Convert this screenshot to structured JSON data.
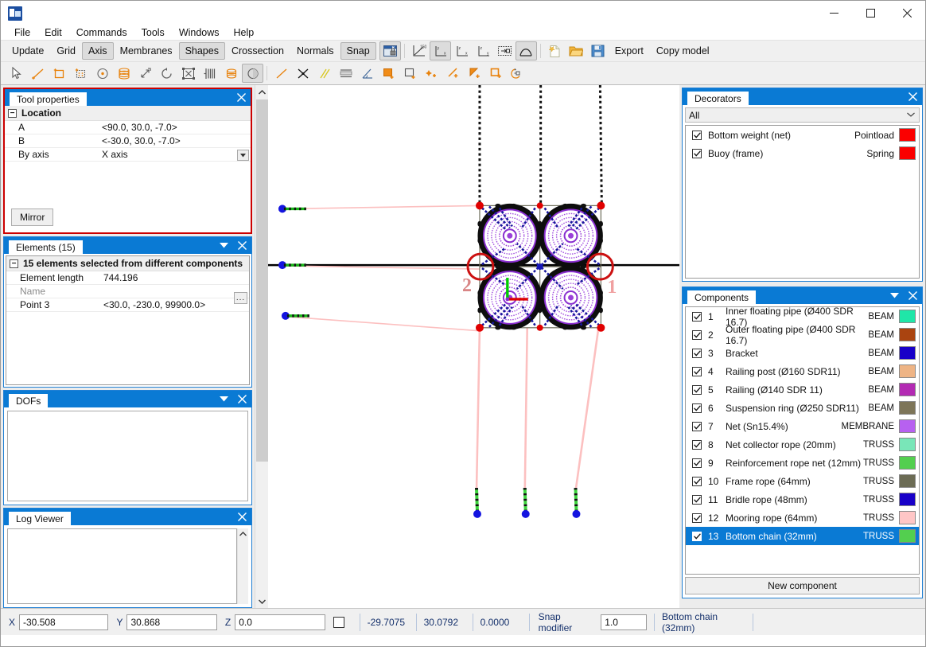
{
  "window": {
    "app_icon": "app-icon",
    "minimize": "—",
    "maximize": "□",
    "close": "✕"
  },
  "menu": {
    "items": [
      "File",
      "Edit",
      "Commands",
      "Tools",
      "Windows",
      "Help"
    ]
  },
  "toolbar_main": {
    "buttons": [
      {
        "label": "Update",
        "active": false
      },
      {
        "label": "Grid",
        "active": false
      },
      {
        "label": "Axis",
        "active": true
      },
      {
        "label": "Membranes",
        "active": false
      },
      {
        "label": "Shapes",
        "active": true
      },
      {
        "label": "Crossection",
        "active": false
      },
      {
        "label": "Normals",
        "active": false
      },
      {
        "label": "Snap",
        "active": true
      }
    ],
    "icon_buttons": [
      {
        "name": "lock-view-icon",
        "active": true
      },
      {
        "name": "iso-view-icon",
        "active": false
      },
      {
        "name": "front-view-icon",
        "active": true
      },
      {
        "name": "side-view-icon",
        "active": false
      },
      {
        "name": "top-view-icon",
        "active": false
      },
      {
        "name": "zoom-extents-icon",
        "active": false
      },
      {
        "name": "shaded-shape-icon",
        "active": true
      },
      {
        "name": "new-file-icon",
        "active": false
      },
      {
        "name": "open-folder-icon",
        "active": false
      },
      {
        "name": "save-disk-icon",
        "active": false
      }
    ],
    "export_label": "Export",
    "copy_model_label": "Copy model"
  },
  "toolbar_tools": {
    "icons": [
      "select-arrow-icon",
      "add-line-icon",
      "add-rectangle-icon",
      "add-grid-icon",
      "add-point-icon",
      "cylinder-icon",
      "scale-icon",
      "rotate-icon",
      "fit-selection-icon",
      "mirror-icon",
      "extrude-icon",
      "shade-half-icon",
      "line-icon",
      "intersect-icon",
      "parallel-icon",
      "equal-length-icon",
      "angle-icon",
      "fill-square-icon",
      "offset-square-icon",
      "add-node-icon",
      "add-beam-icon",
      "add-triangle-icon",
      "add-quad-icon",
      "add-spring-icon"
    ]
  },
  "tool_properties": {
    "title": "Tool properties",
    "close": "✕",
    "group": {
      "label": "Location",
      "expander": "−"
    },
    "rows": [
      {
        "key": "A",
        "value": "<90.0, 30.0, -7.0>",
        "kind": "text"
      },
      {
        "key": "B",
        "value": "<-30.0, 30.0, -7.0>",
        "kind": "text"
      },
      {
        "key": "By axis",
        "value": "X axis",
        "kind": "combo"
      }
    ],
    "mirror_button": "Mirror"
  },
  "elements": {
    "title": "Elements (15)",
    "close": "✕",
    "menu": "▼",
    "group": {
      "label": "15 elements selected from different components",
      "expander": "−"
    },
    "rows": [
      {
        "key": "Element length",
        "value": "744.196",
        "kind": "text",
        "dim": false
      },
      {
        "key": "Name",
        "value": "",
        "kind": "dots",
        "dim": true
      },
      {
        "key": "Point 3",
        "value": "<30.0, -230.0, 99900.0>",
        "kind": "text",
        "dim": false
      }
    ]
  },
  "dofs": {
    "title": "DOFs",
    "close": "✕",
    "menu": "▼"
  },
  "log_viewer": {
    "title": "Log Viewer",
    "close": "✕"
  },
  "decorators": {
    "title": "Decorators",
    "close": "✕",
    "filter": "All",
    "filter_chevron": "⌄",
    "items": [
      {
        "checked": true,
        "name": "Bottom weight (net)",
        "type": "Pointload",
        "color": "#fb0000"
      },
      {
        "checked": true,
        "name": "Buoy (frame)",
        "type": "Spring",
        "color": "#fb0000"
      }
    ]
  },
  "components": {
    "title": "Components",
    "close": "✕",
    "menu": "▼",
    "new_button": "New component",
    "items": [
      {
        "num": "1",
        "checked": true,
        "name": "Inner floating pipe (Ø400 SDR 16.7)",
        "type": "BEAM",
        "color": "#1fe6a8",
        "selected": false
      },
      {
        "num": "2",
        "checked": true,
        "name": "Outer floating pipe (Ø400 SDR 16.7)",
        "type": "BEAM",
        "color": "#aa4410",
        "selected": false
      },
      {
        "num": "3",
        "checked": true,
        "name": "Bracket",
        "type": "BEAM",
        "color": "#1800c8",
        "selected": false
      },
      {
        "num": "4",
        "checked": true,
        "name": "Railing post (Ø160 SDR11)",
        "type": "BEAM",
        "color": "#eeb485",
        "selected": false
      },
      {
        "num": "5",
        "checked": true,
        "name": "Railing (Ø140 SDR 11)",
        "type": "BEAM",
        "color": "#b32bb3",
        "selected": false
      },
      {
        "num": "6",
        "checked": true,
        "name": "Suspension ring (Ø250 SDR11)",
        "type": "BEAM",
        "color": "#7d7558",
        "selected": false
      },
      {
        "num": "7",
        "checked": true,
        "name": "Net (Sn15.4%)",
        "type": "MEMBRANE",
        "color": "#b761f0",
        "selected": false
      },
      {
        "num": "8",
        "checked": true,
        "name": "Net collector rope (20mm)",
        "type": "TRUSS",
        "color": "#79e6b8",
        "selected": false
      },
      {
        "num": "9",
        "checked": true,
        "name": "Reinforcement rope net (12mm)",
        "type": "TRUSS",
        "color": "#53cf4f",
        "selected": false
      },
      {
        "num": "10",
        "checked": true,
        "name": "Frame rope (64mm)",
        "type": "TRUSS",
        "color": "#6b6b54",
        "selected": false
      },
      {
        "num": "11",
        "checked": true,
        "name": "Bridle rope (48mm)",
        "type": "TRUSS",
        "color": "#1800c8",
        "selected": false
      },
      {
        "num": "12",
        "checked": true,
        "name": "Mooring rope (64mm)",
        "type": "TRUSS",
        "color": "#ffc6c6",
        "selected": false
      },
      {
        "num": "13",
        "checked": true,
        "name": "Bottom chain (32mm)",
        "type": "TRUSS",
        "color": "#53cf4f",
        "selected": true
      }
    ]
  },
  "viewport": {
    "annotation_1": "1",
    "annotation_2": "2",
    "axis_gizmo": {
      "y_color": "#00cc00",
      "x_color": "#dd0000"
    }
  },
  "statusbar": {
    "x_label": "X",
    "x_value": "-30.508",
    "y_label": "Y",
    "y_value": "30.868",
    "z_label": "Z",
    "z_value": "0.0",
    "lock_checked": false,
    "readout1": "-29.7075",
    "readout2": "30.0792",
    "readout3": "0.0000",
    "snap_label": "Snap modifier",
    "snap_value": "1.0",
    "active_component": "Bottom chain (32mm)"
  }
}
